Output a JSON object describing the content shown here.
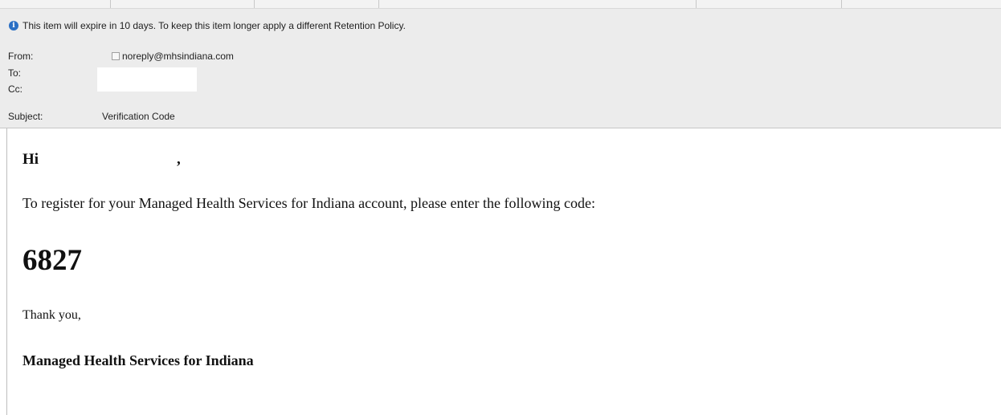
{
  "info_bar": {
    "icon": "info-icon",
    "text": "This item will expire in 10 days. To keep this item longer apply a different Retention Policy."
  },
  "header": {
    "from_label": "From:",
    "from_value": "noreply@mhsindiana.com",
    "to_label": "To:",
    "cc_label": "Cc:",
    "subject_label": "Subject:",
    "subject_value": "Verification Code"
  },
  "body": {
    "greeting": "Hi",
    "greeting_comma": ",",
    "intro": "To register for your Managed Health Services for Indiana account, please enter the following code:",
    "code": "6827",
    "thanks": "Thank you,",
    "signature": "Managed Health Services for Indiana"
  },
  "colors": {
    "header_bg": "#ececec",
    "info_icon": "#2a6fc4",
    "body_bg": "#ffffff"
  }
}
